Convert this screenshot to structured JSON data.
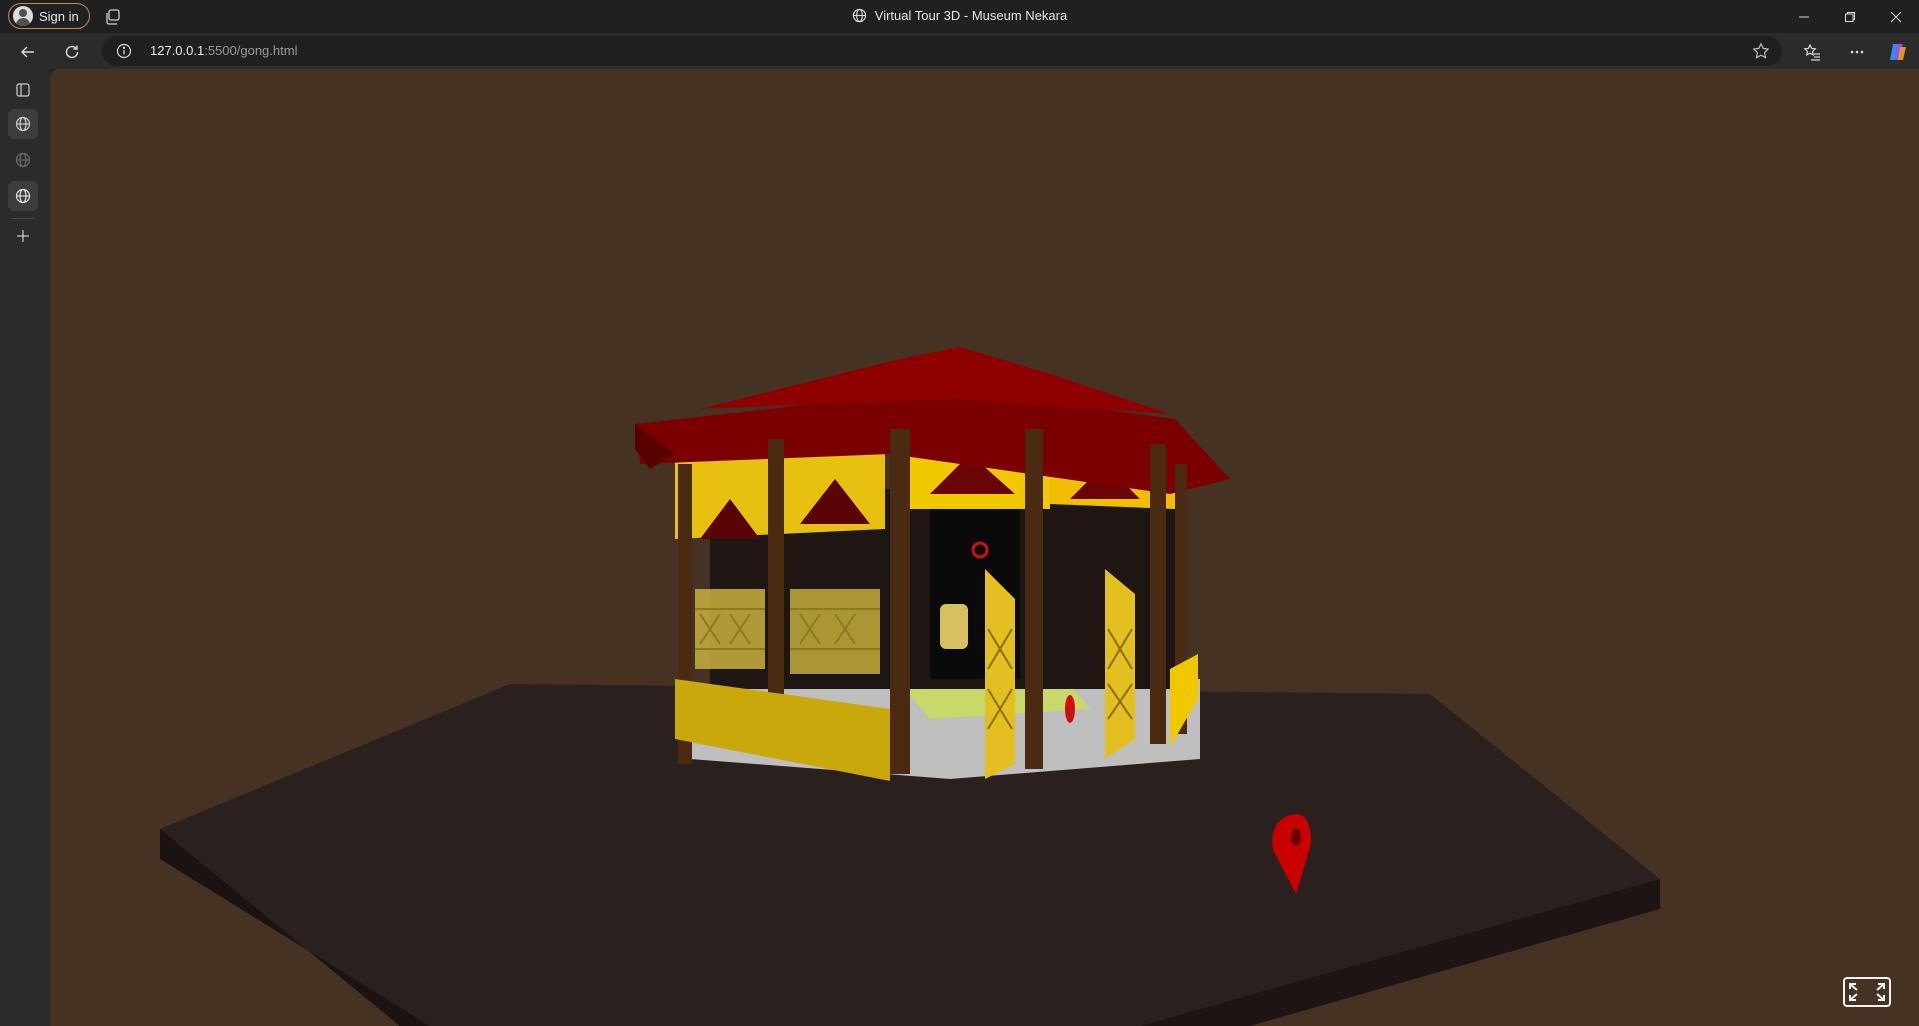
{
  "window": {
    "title": "Virtual Tour 3D - Museum Nekara",
    "sign_in_label": "Sign in",
    "controls": [
      "minimize-icon",
      "restore-icon",
      "close-icon"
    ]
  },
  "address_bar": {
    "url_host": "127.0.0.1",
    "url_rest": ":5500/gong.html"
  },
  "sidebar": {
    "items": [
      "sidebar-toggle-icon",
      "globe-icon",
      "globe-icon",
      "globe-icon",
      "plus-icon"
    ],
    "active_index": 3
  },
  "scene": {
    "background_color": "#453222",
    "platform_color": "#2a201d",
    "roof_color": "#7b0000",
    "wall_color": "#f0c000",
    "pillar_color": "#4a2a10",
    "marker_color": "#cc0000"
  },
  "fullscreen_button": "fullscreen-icon"
}
